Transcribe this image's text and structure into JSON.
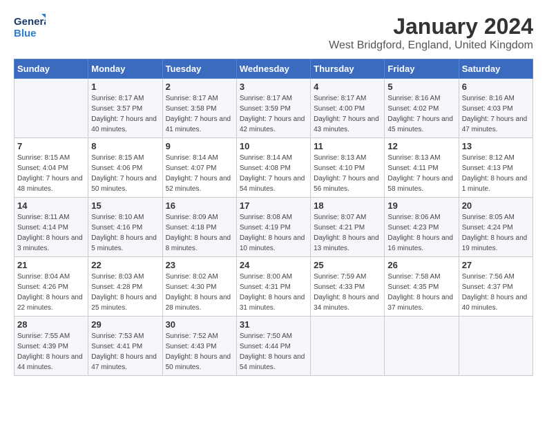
{
  "logo": {
    "line1": "General",
    "line2": "Blue"
  },
  "title": "January 2024",
  "subtitle": "West Bridgford, England, United Kingdom",
  "days_of_week": [
    "Sunday",
    "Monday",
    "Tuesday",
    "Wednesday",
    "Thursday",
    "Friday",
    "Saturday"
  ],
  "weeks": [
    [
      {
        "num": "",
        "sunrise": "",
        "sunset": "",
        "daylight": ""
      },
      {
        "num": "1",
        "sunrise": "Sunrise: 8:17 AM",
        "sunset": "Sunset: 3:57 PM",
        "daylight": "Daylight: 7 hours and 40 minutes."
      },
      {
        "num": "2",
        "sunrise": "Sunrise: 8:17 AM",
        "sunset": "Sunset: 3:58 PM",
        "daylight": "Daylight: 7 hours and 41 minutes."
      },
      {
        "num": "3",
        "sunrise": "Sunrise: 8:17 AM",
        "sunset": "Sunset: 3:59 PM",
        "daylight": "Daylight: 7 hours and 42 minutes."
      },
      {
        "num": "4",
        "sunrise": "Sunrise: 8:17 AM",
        "sunset": "Sunset: 4:00 PM",
        "daylight": "Daylight: 7 hours and 43 minutes."
      },
      {
        "num": "5",
        "sunrise": "Sunrise: 8:16 AM",
        "sunset": "Sunset: 4:02 PM",
        "daylight": "Daylight: 7 hours and 45 minutes."
      },
      {
        "num": "6",
        "sunrise": "Sunrise: 8:16 AM",
        "sunset": "Sunset: 4:03 PM",
        "daylight": "Daylight: 7 hours and 47 minutes."
      }
    ],
    [
      {
        "num": "7",
        "sunrise": "Sunrise: 8:15 AM",
        "sunset": "Sunset: 4:04 PM",
        "daylight": "Daylight: 7 hours and 48 minutes."
      },
      {
        "num": "8",
        "sunrise": "Sunrise: 8:15 AM",
        "sunset": "Sunset: 4:06 PM",
        "daylight": "Daylight: 7 hours and 50 minutes."
      },
      {
        "num": "9",
        "sunrise": "Sunrise: 8:14 AM",
        "sunset": "Sunset: 4:07 PM",
        "daylight": "Daylight: 7 hours and 52 minutes."
      },
      {
        "num": "10",
        "sunrise": "Sunrise: 8:14 AM",
        "sunset": "Sunset: 4:08 PM",
        "daylight": "Daylight: 7 hours and 54 minutes."
      },
      {
        "num": "11",
        "sunrise": "Sunrise: 8:13 AM",
        "sunset": "Sunset: 4:10 PM",
        "daylight": "Daylight: 7 hours and 56 minutes."
      },
      {
        "num": "12",
        "sunrise": "Sunrise: 8:13 AM",
        "sunset": "Sunset: 4:11 PM",
        "daylight": "Daylight: 7 hours and 58 minutes."
      },
      {
        "num": "13",
        "sunrise": "Sunrise: 8:12 AM",
        "sunset": "Sunset: 4:13 PM",
        "daylight": "Daylight: 8 hours and 1 minute."
      }
    ],
    [
      {
        "num": "14",
        "sunrise": "Sunrise: 8:11 AM",
        "sunset": "Sunset: 4:14 PM",
        "daylight": "Daylight: 8 hours and 3 minutes."
      },
      {
        "num": "15",
        "sunrise": "Sunrise: 8:10 AM",
        "sunset": "Sunset: 4:16 PM",
        "daylight": "Daylight: 8 hours and 5 minutes."
      },
      {
        "num": "16",
        "sunrise": "Sunrise: 8:09 AM",
        "sunset": "Sunset: 4:18 PM",
        "daylight": "Daylight: 8 hours and 8 minutes."
      },
      {
        "num": "17",
        "sunrise": "Sunrise: 8:08 AM",
        "sunset": "Sunset: 4:19 PM",
        "daylight": "Daylight: 8 hours and 10 minutes."
      },
      {
        "num": "18",
        "sunrise": "Sunrise: 8:07 AM",
        "sunset": "Sunset: 4:21 PM",
        "daylight": "Daylight: 8 hours and 13 minutes."
      },
      {
        "num": "19",
        "sunrise": "Sunrise: 8:06 AM",
        "sunset": "Sunset: 4:23 PM",
        "daylight": "Daylight: 8 hours and 16 minutes."
      },
      {
        "num": "20",
        "sunrise": "Sunrise: 8:05 AM",
        "sunset": "Sunset: 4:24 PM",
        "daylight": "Daylight: 8 hours and 19 minutes."
      }
    ],
    [
      {
        "num": "21",
        "sunrise": "Sunrise: 8:04 AM",
        "sunset": "Sunset: 4:26 PM",
        "daylight": "Daylight: 8 hours and 22 minutes."
      },
      {
        "num": "22",
        "sunrise": "Sunrise: 8:03 AM",
        "sunset": "Sunset: 4:28 PM",
        "daylight": "Daylight: 8 hours and 25 minutes."
      },
      {
        "num": "23",
        "sunrise": "Sunrise: 8:02 AM",
        "sunset": "Sunset: 4:30 PM",
        "daylight": "Daylight: 8 hours and 28 minutes."
      },
      {
        "num": "24",
        "sunrise": "Sunrise: 8:00 AM",
        "sunset": "Sunset: 4:31 PM",
        "daylight": "Daylight: 8 hours and 31 minutes."
      },
      {
        "num": "25",
        "sunrise": "Sunrise: 7:59 AM",
        "sunset": "Sunset: 4:33 PM",
        "daylight": "Daylight: 8 hours and 34 minutes."
      },
      {
        "num": "26",
        "sunrise": "Sunrise: 7:58 AM",
        "sunset": "Sunset: 4:35 PM",
        "daylight": "Daylight: 8 hours and 37 minutes."
      },
      {
        "num": "27",
        "sunrise": "Sunrise: 7:56 AM",
        "sunset": "Sunset: 4:37 PM",
        "daylight": "Daylight: 8 hours and 40 minutes."
      }
    ],
    [
      {
        "num": "28",
        "sunrise": "Sunrise: 7:55 AM",
        "sunset": "Sunset: 4:39 PM",
        "daylight": "Daylight: 8 hours and 44 minutes."
      },
      {
        "num": "29",
        "sunrise": "Sunrise: 7:53 AM",
        "sunset": "Sunset: 4:41 PM",
        "daylight": "Daylight: 8 hours and 47 minutes."
      },
      {
        "num": "30",
        "sunrise": "Sunrise: 7:52 AM",
        "sunset": "Sunset: 4:43 PM",
        "daylight": "Daylight: 8 hours and 50 minutes."
      },
      {
        "num": "31",
        "sunrise": "Sunrise: 7:50 AM",
        "sunset": "Sunset: 4:44 PM",
        "daylight": "Daylight: 8 hours and 54 minutes."
      },
      {
        "num": "",
        "sunrise": "",
        "sunset": "",
        "daylight": ""
      },
      {
        "num": "",
        "sunrise": "",
        "sunset": "",
        "daylight": ""
      },
      {
        "num": "",
        "sunrise": "",
        "sunset": "",
        "daylight": ""
      }
    ]
  ]
}
